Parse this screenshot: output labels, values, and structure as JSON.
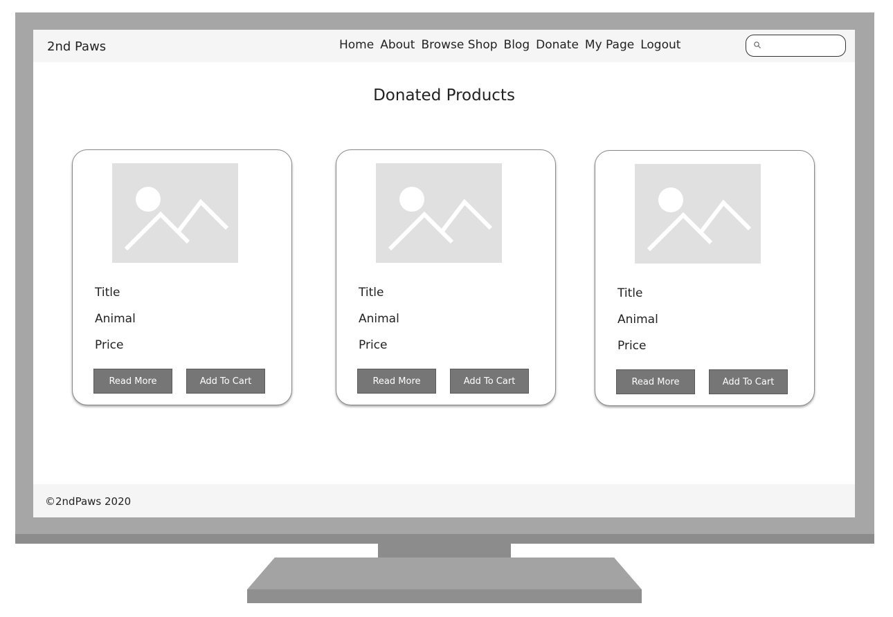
{
  "navbar": {
    "brand": "2nd Paws",
    "links": [
      "Home",
      "About",
      "Browse Shop",
      "Blog",
      "Donate",
      "My Page",
      "Logout"
    ],
    "search_icon": "search-icon",
    "search_placeholder": ""
  },
  "main": {
    "title": "Donated Products",
    "products": [
      {
        "image_icon": "image-placeholder-icon",
        "title": "Title",
        "animal": "Animal",
        "price": "Price",
        "read_more_label": "Read More",
        "add_to_cart_label": "Add To Cart"
      },
      {
        "image_icon": "image-placeholder-icon",
        "title": "Title",
        "animal": "Animal",
        "price": "Price",
        "read_more_label": "Read More",
        "add_to_cart_label": "Add To Cart"
      },
      {
        "image_icon": "image-placeholder-icon",
        "title": "Title",
        "animal": "Animal",
        "price": "Price",
        "read_more_label": "Read More",
        "add_to_cart_label": "Add To Cart"
      }
    ]
  },
  "footer": {
    "copyright": "©2ndPaws 2020"
  },
  "colors": {
    "navbar_background": "#f5f5f5",
    "button_background": "#767676",
    "image_placeholder": "#e0e0e0",
    "monitor_frame": "#a6a6a6"
  }
}
